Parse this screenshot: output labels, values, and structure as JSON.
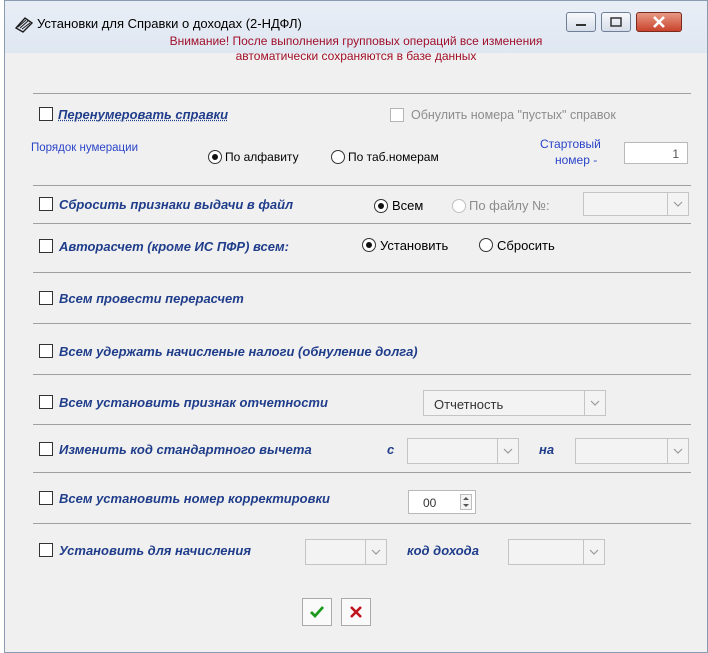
{
  "window": {
    "title": "Установки для Справки о доходах (2-НДФЛ)",
    "notice_line1": "Внимание! После выполнения групповых операций все изменения",
    "notice_line2": "автоматически сохраняются в базе данных"
  },
  "renumber": {
    "label": "Перенумеровать справки",
    "reset_empty_label": "Обнулить номера \"пустых\" справок",
    "order_label": "Порядок нумерации",
    "radio_alpha": "По алфавиту",
    "radio_tab": "По таб.номерам",
    "start_label_1": "Стартовый",
    "start_label_2": "номер -",
    "start_value": "1"
  },
  "reset_issue": {
    "label": "Сбросить признаки выдачи в файл",
    "radio_all": "Всем",
    "radio_file": "По файлу №:"
  },
  "autocalc": {
    "label": "Авторасчет (кроме ИС ПФР) всем:",
    "radio_set": "Установить",
    "radio_reset": "Сбросить"
  },
  "recalc": {
    "label": "Всем провести перерасчет"
  },
  "withhold": {
    "label": "Всем удержать начисленые налоги (обнуление долга)"
  },
  "report_flag": {
    "label": "Всем установить признак отчетности",
    "combo_value": "Отчетность"
  },
  "deduction": {
    "label": "Изменить код стандартного вычета",
    "from_label": "с",
    "to_label": "на"
  },
  "correction": {
    "label": "Всем установить номер корректировки",
    "value": "00"
  },
  "accrual": {
    "label": "Установить для начисления",
    "income_label": "код дохода"
  },
  "colors": {
    "label_blue": "#1f3d8a",
    "notice_red": "#a0102a",
    "ok_green": "#1a9a1a",
    "cancel_red": "#c0141e"
  }
}
